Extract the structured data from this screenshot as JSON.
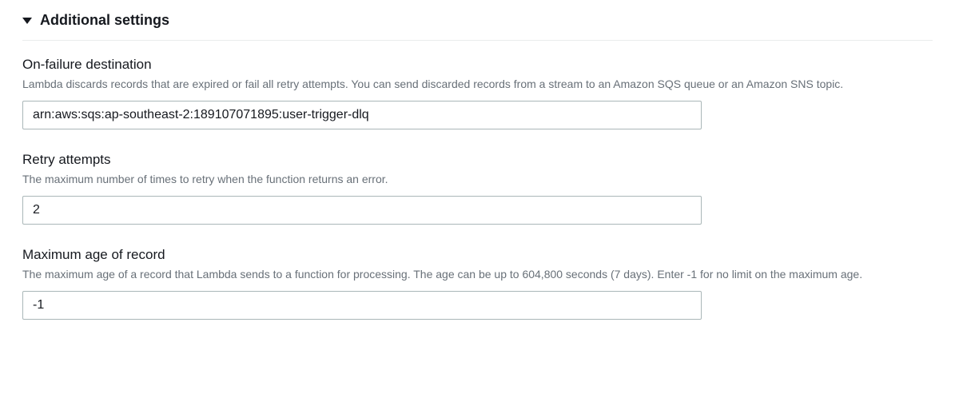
{
  "section": {
    "title": "Additional settings"
  },
  "fields": {
    "onFailureDestination": {
      "label": "On-failure destination",
      "description": "Lambda discards records that are expired or fail all retry attempts. You can send discarded records from a stream to an Amazon SQS queue or an Amazon SNS topic.",
      "value": "arn:aws:sqs:ap-southeast-2:189107071895:user-trigger-dlq"
    },
    "retryAttempts": {
      "label": "Retry attempts",
      "description": "The maximum number of times to retry when the function returns an error.",
      "value": "2"
    },
    "maxAgeOfRecord": {
      "label": "Maximum age of record",
      "description": "The maximum age of a record that Lambda sends to a function for processing. The age can be up to 604,800 seconds (7 days). Enter -1 for no limit on the maximum age.",
      "value": "-1"
    }
  }
}
